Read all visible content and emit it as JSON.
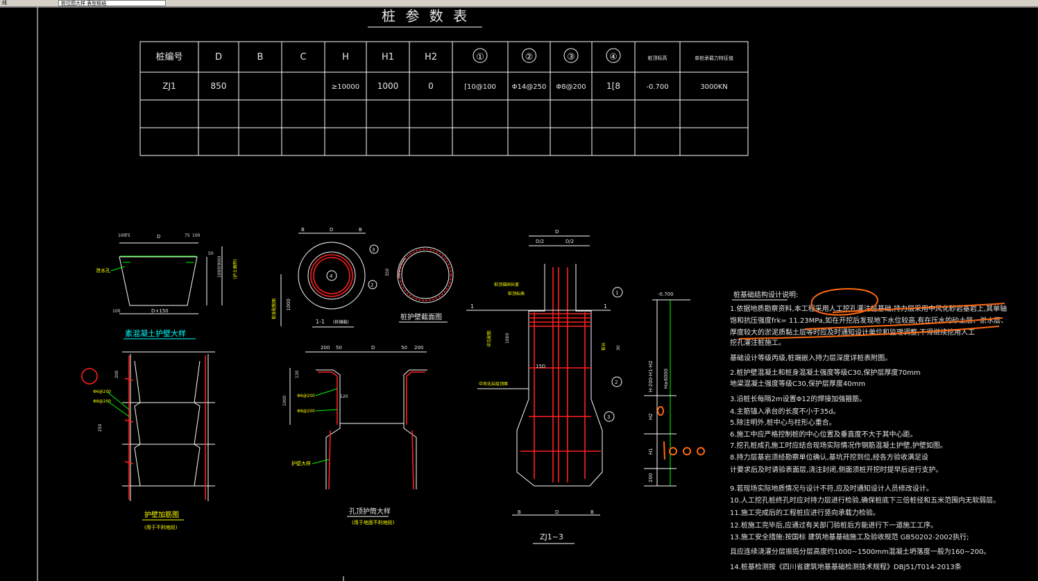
{
  "window": {
    "tab1": "线",
    "tab2": "桩位图大样 表型板结"
  },
  "table": {
    "title": "桩 参 数 表",
    "headers": [
      "桩编号",
      "D",
      "B",
      "C",
      "H",
      "H1",
      "H2",
      "①",
      "②",
      "③",
      "④",
      "桩顶标高",
      "单桩承载力特征值"
    ],
    "rows": [
      [
        "ZJ1",
        "850",
        "",
        "",
        "≥10000",
        "1000",
        "0",
        "[10@100",
        "Φ14@250",
        "Φ8@200",
        "1[8",
        "-0.700",
        "3000KN"
      ],
      [
        "",
        "",
        "",
        "",
        "",
        "",
        "",
        "",
        "",
        "",
        "",
        "",
        ""
      ],
      [
        "",
        "",
        "",
        "",
        "",
        "",
        "",
        "",
        "",
        "",
        "",
        "",
        ""
      ]
    ]
  },
  "details": {
    "wall_title": "素混凝土护壁大样",
    "wall_label_water": "泄水孔",
    "wall_dims": [
      "100",
      "75",
      "D",
      "75",
      "100",
      "D+150",
      "100",
      "1000(900)",
      "(护土面积)",
      "50"
    ],
    "section_title": "1-1",
    "section_sub": "(桩横截)",
    "section_dim_1000": "1000",
    "section_label_left": "桩身配筋图",
    "protect_title": "桩护壁截面图",
    "protect_dim": "350",
    "reinforce_title": "护壁加筋图",
    "reinforce_sub": "(用于不利地段)",
    "reinforce_labels": [
      "Φ6@200",
      "Φ8@200"
    ],
    "reinforce_dims": [
      "200",
      "250"
    ],
    "top_title": "孔顶护筒大样",
    "top_sub": "(用于地面不利地段)",
    "top_dims": [
      "200",
      "50",
      "D",
      "50",
      "200",
      "120",
      "1000",
      "120"
    ],
    "top_labels": [
      "Φ6@200",
      "Φ8@200",
      "护壁大样"
    ],
    "pile_title": "ZJ1~3",
    "pile_dims": [
      "D",
      "D/2",
      "D/2",
      "B",
      "D",
      "B",
      "15D",
      "1000",
      "30"
    ],
    "pile_labels": [
      "桩顶锚固长度",
      "桩顶标高",
      "详见配筋",
      "中风化岩层顶面",
      "桩长"
    ],
    "elev_dims": [
      "-0.700",
      "H≥6000",
      "H-200-H1-H2",
      "H2",
      "H1",
      "200"
    ],
    "markers": [
      "1",
      "2",
      "3",
      "4"
    ]
  },
  "notes": {
    "title": "桩基础结构设计说明:",
    "lines": [
      "1.依据地质勘察资料,本工程采用人工挖孔灌注桩基础,持力层采用中风化砂岩基岩上,其单轴",
      "  饱和抗压强度frk= 11.23MPa,如在开挖后发现地下水位较高,有在压水的砂土层、淤水层、",
      "  厚度较大的淤泥质黏土层等时应及时通知设计单位和监理调整,不得继续挖用人工",
      "  挖孔灌注桩施工。",
      "  基础设计等级丙级,桩端嵌入持力层深度详桩表附图。",
      "2.桩护壁混凝土和桩身混凝土强度等级C30,保护层厚度70mm",
      "  地梁混凝土强度等级C30,保护层厚度40mm",
      "3.沿桩长每隔2m设置Φ12的焊接加强箍筋。",
      "4.主筋锚入承台的长度不小于35d。",
      "5.除注明外,桩中心与柱形心重合。",
      "6.施工中应严格控制桩的中心位置及垂直度不大于其中心距。",
      "7.挖孔桩成孔施工时应结合现场实际情况作钢筋混凝土护壁,护壁如图。",
      "8.持力层基岩须经勘察单位确认,基坑开挖到位,经各方验收满足设",
      "  计要求后及时请验表面层,浇注封闭,侧面须桩开挖时提早后进行支护。",
      "9.若现场实际地质情况与设计不符,应及时通知设计人员修改设计。",
      "10.人工挖孔桩终孔时应对持力层进行检验,确保桩底下三倍桩径和五米范围内无软弱层。",
      "11.施工完成后的工程桩应进行竖向承载力检验。",
      "12.桩施工完毕后,应通过有关部门验桩后方能进行下一道施工工序。",
      "13.施工安全措施:按国标  建筑地基基础施工及验收规范  GB50202-2002执行;",
      "  且应连续浇灌分层振捣分层高度约1000~1500mm混凝土坍落度一般为160~200。",
      "14.桩基检测按《四川省建筑地基基础检测技术规程》DBJ51/T014-2013条"
    ]
  },
  "annotations": {
    "handwritten": "1000",
    "handwritten_small": "0"
  },
  "colors": {
    "background": "#000000",
    "line": "#ffffff",
    "rebar": "#ff2020",
    "dimension": "#00ff00",
    "label": "#ffff00",
    "markup": "#ff6a10"
  }
}
